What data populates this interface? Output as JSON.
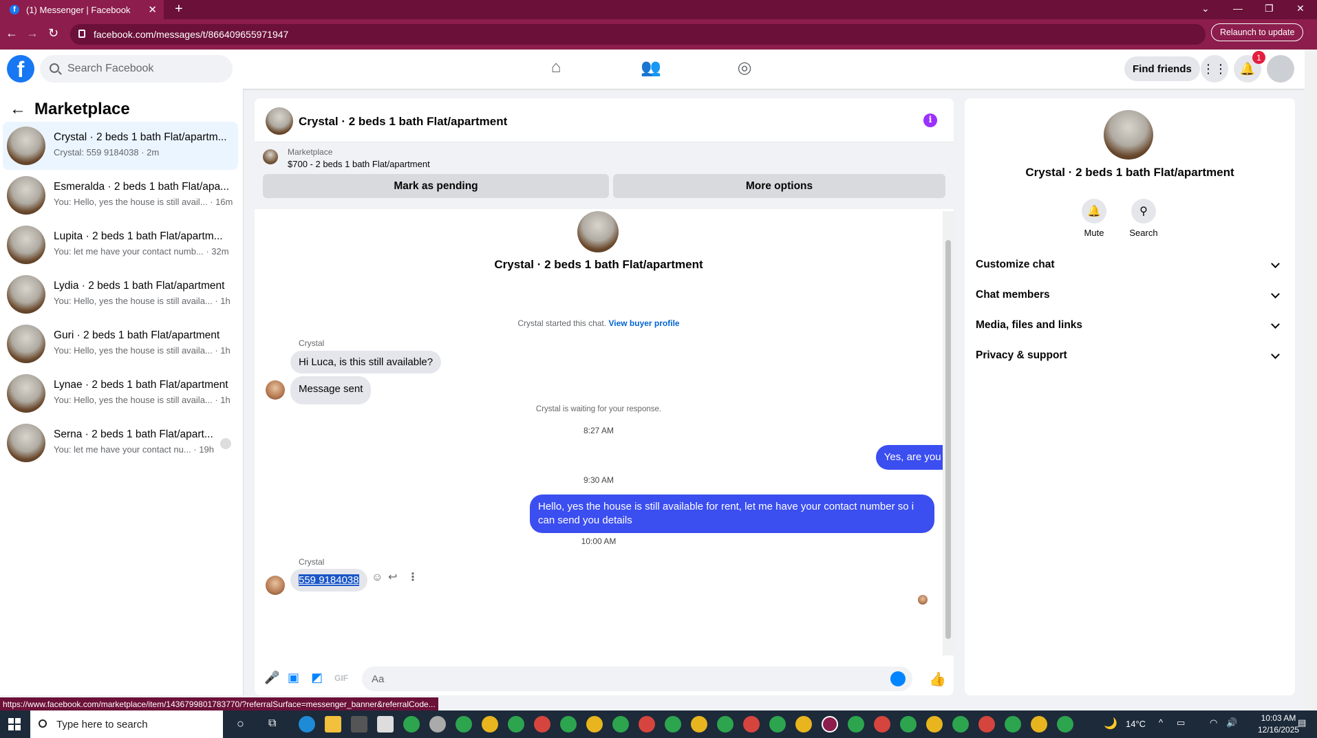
{
  "browser": {
    "tab_title": "(1) Messenger | Facebook",
    "url": "facebook.com/messages/t/866409655971947",
    "relaunch_label": "Relaunch to update"
  },
  "header": {
    "search_placeholder": "Search Facebook",
    "find_friends": "Find friends",
    "notifications_count": "1"
  },
  "sidebar": {
    "title": "Marketplace",
    "conversations": [
      {
        "name": "Crystal · 2 beds 1 bath Flat/apartm...",
        "preview": "Crystal: 559 9184038 · 2m"
      },
      {
        "name": "Esmeralda · 2 beds 1 bath Flat/apa...",
        "preview": "You: Hello, yes the house is still avail... · 16m"
      },
      {
        "name": "Lupita · 2 beds 1 bath Flat/apartm...",
        "preview": "You: let me have your contact numb... · 32m"
      },
      {
        "name": "Lydia · 2 beds 1 bath Flat/apartment",
        "preview": "You: Hello, yes the house is still availa... · 1h"
      },
      {
        "name": "Guri · 2 beds 1 bath Flat/apartment",
        "preview": "You: Hello, yes the house is still availa... · 1h"
      },
      {
        "name": "Lynae · 2 beds 1 bath Flat/apartment",
        "preview": "You: Hello, yes the house is still availa... · 1h"
      },
      {
        "name": "Serna · 2 beds 1 bath Flat/apart...",
        "preview": "You: let me have your contact nu... · 19h"
      }
    ]
  },
  "chat": {
    "title": "Crystal · 2 beds 1 bath Flat/apartment",
    "banner": {
      "label": "Marketplace",
      "item": "$700 - 2 beds 1 bath Flat/apartment",
      "pending_button": "Mark as pending",
      "more_button": "More options"
    },
    "intro_name": "Crystal · 2 beds 1 bath Flat/apartment",
    "started_text": "Crystal started this chat.",
    "buyer_profile_link": "View buyer profile",
    "sender_name": "Crystal",
    "msg_in_1": "Hi Luca, is this still available?",
    "msg_in_2": "Message sent",
    "waiting_text": "Crystal is waiting for your response.",
    "time_1": "8:27 AM",
    "msg_out_1": "Yes, are you interested?",
    "time_2": "9:30 AM",
    "msg_out_2": "Hello, yes the house is still available for rent, let me have your contact number so i can send you details",
    "time_3": "10:00 AM",
    "sender_name_2": "Crystal",
    "msg_in_3": "559 9184038",
    "composer_placeholder": "Aa"
  },
  "details": {
    "name": "Crystal · 2 beds 1 bath Flat/apartment",
    "mute": "Mute",
    "search": "Search",
    "sections": [
      "Customize chat",
      "Chat members",
      "Media, files and links",
      "Privacy & support"
    ]
  },
  "status_url": "https://www.facebook.com/marketplace/item/1436799801783770/?referralSurface=messenger_banner&referralCode...",
  "taskbar": {
    "search_placeholder": "Type here to search",
    "temperature": "14°C",
    "time": "10:03 AM",
    "date": "12/16/2025"
  }
}
